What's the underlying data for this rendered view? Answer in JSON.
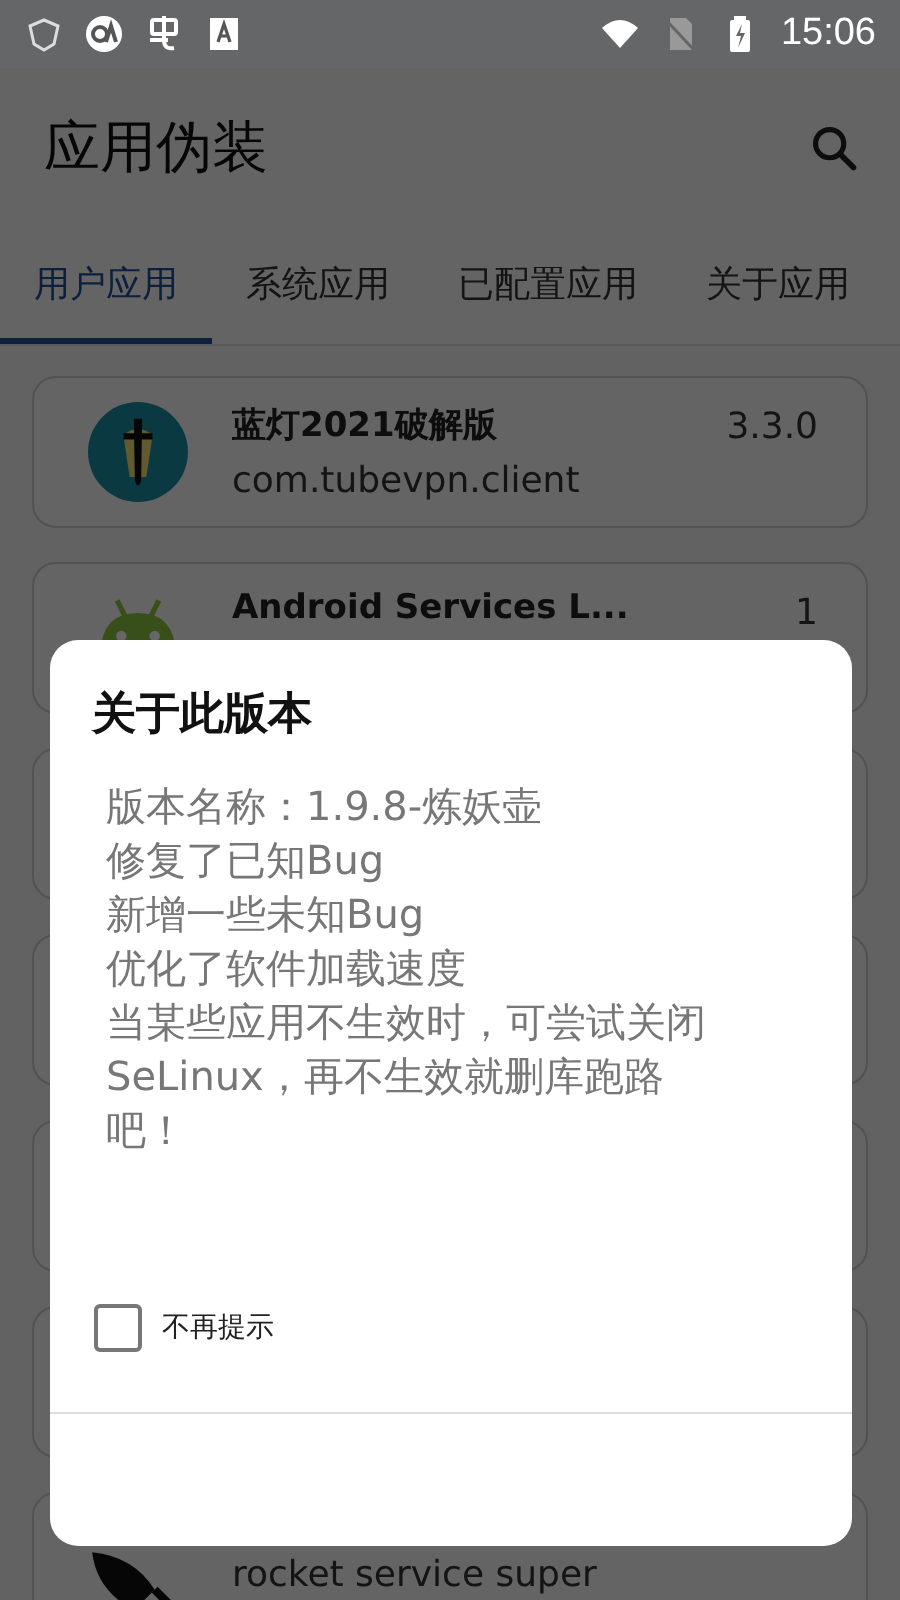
{
  "status_bar": {
    "time": "15:06"
  },
  "app_bar": {
    "title": "应用伪装"
  },
  "tabs": [
    {
      "label": "用户应用",
      "selected": true
    },
    {
      "label": "系统应用",
      "selected": false
    },
    {
      "label": "已配置应用",
      "selected": false
    },
    {
      "label": "关于应用",
      "selected": false
    }
  ],
  "apps": [
    {
      "kind": "lantern",
      "name": "蓝灯2021破解版",
      "package": "com.tubevpn.client",
      "version": "3.3.0"
    },
    {
      "kind": "android",
      "name": "Android Services L...",
      "version": "1"
    },
    {
      "kind": "hidden"
    },
    {
      "kind": "hidden"
    },
    {
      "kind": "hidden"
    },
    {
      "kind": "hidden"
    },
    {
      "kind": "rocket",
      "package": "rocket service super"
    }
  ],
  "dialog": {
    "title": "关于此版本",
    "body_lines": [
      "版本名称：1.9.8-炼妖壶",
      "修复了已知Bug",
      "新增一些未知Bug",
      "优化了软件加载速度",
      "当某些应用不生效时，可尝试关闭SeLinux，再不生效就删库跑路吧！"
    ],
    "checkbox": {
      "label": "不再提示",
      "checked": false
    }
  }
}
